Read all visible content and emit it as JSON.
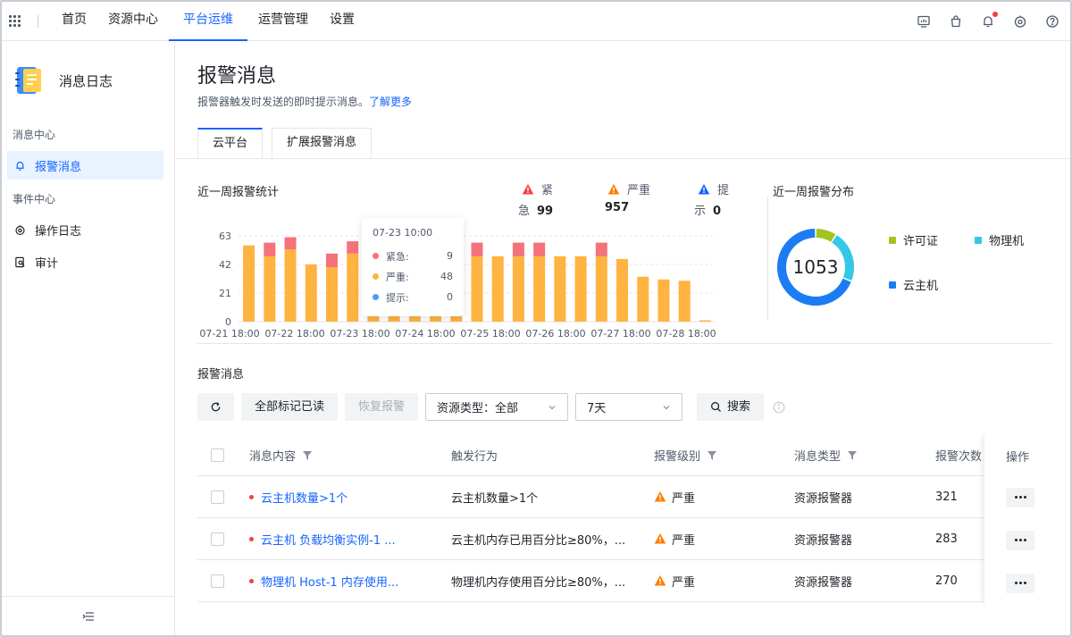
{
  "nav": {
    "items": [
      {
        "label": "首页"
      },
      {
        "label": "资源中心"
      },
      {
        "label": "平台运维"
      },
      {
        "label": "运营管理"
      },
      {
        "label": "设置"
      }
    ]
  },
  "sidebar": {
    "title": "消息日志",
    "group1": "消息中心",
    "group2": "事件中心",
    "items": [
      {
        "label": "报警消息"
      },
      {
        "label": "操作日志"
      },
      {
        "label": "审计"
      }
    ]
  },
  "page": {
    "title": "报警消息",
    "desc": "报警器触发时发送的即时提示消息。",
    "link": "了解更多"
  },
  "tabs": [
    {
      "label": "云平台"
    },
    {
      "label": "扩展报警消息"
    }
  ],
  "stats": {
    "title": "近一周报警统计",
    "urgent_label_a": "紧",
    "urgent_label_b": "急",
    "urgent_value": "99",
    "serious_label": "严重",
    "serious_value": "957",
    "hint_label_a": "提",
    "hint_label_b": "示",
    "hint_value": "0"
  },
  "chart_data": {
    "type": "bar",
    "stacked": true,
    "yticks": [
      "0",
      "21",
      "42",
      "63"
    ],
    "ylim": [
      0,
      63
    ],
    "xticks": [
      "07-21 18:00",
      "07-22 18:00",
      "07-23 18:00",
      "07-24 18:00",
      "07-25 18:00",
      "07-26 18:00",
      "07-27 18:00",
      "07-28 18:00"
    ],
    "series": [
      {
        "name": "严重",
        "color": "#ffb340",
        "values": [
          56,
          48,
          53,
          42,
          40,
          50,
          48,
          52,
          48,
          48,
          47,
          48,
          48,
          48,
          48,
          48,
          48,
          48,
          46,
          33,
          31,
          30,
          1
        ]
      },
      {
        "name": "紧急",
        "color": "#f5727a",
        "values": [
          0,
          10,
          9,
          0,
          10,
          9,
          9,
          8,
          8,
          10,
          10,
          10,
          0,
          10,
          10,
          0,
          0,
          10,
          0,
          0,
          0,
          0,
          0
        ]
      }
    ],
    "tooltip": {
      "time": "07-23 10:00",
      "rows": [
        {
          "name": "紧急:",
          "value": "9",
          "color": "#f5727a"
        },
        {
          "name": "严重:",
          "value": "48",
          "color": "#ffb340"
        },
        {
          "name": "提示:",
          "value": "0",
          "color": "#4a9ff5"
        }
      ]
    }
  },
  "distribution": {
    "title": "近一周报警分布",
    "total": "1053",
    "legend": [
      {
        "label": "许可证",
        "color": "#a0c520"
      },
      {
        "label": "物理机",
        "color": "#33c9e6"
      },
      {
        "label": "云主机",
        "color": "#1c7cf4"
      }
    ],
    "segments": [
      {
        "name": "许可证",
        "fraction": 0.09,
        "color": "#a0c520"
      },
      {
        "name": "物理机",
        "fraction": 0.22,
        "color": "#33c9e6"
      },
      {
        "name": "云主机",
        "fraction": 0.69,
        "color": "#1c7cf4"
      }
    ]
  },
  "list": {
    "title": "报警消息",
    "mark_read": "全部标记已读",
    "restore": "恢复报警",
    "resource_type": "资源类型：全部",
    "period": "7天",
    "search": "搜索"
  },
  "table": {
    "headers": {
      "content": "消息内容",
      "trigger": "触发行为",
      "level": "报警级别",
      "type": "消息类型",
      "count": "报警次数",
      "op": "操作"
    },
    "rows": [
      {
        "content": "云主机数量>1个",
        "trigger": "云主机数量>1个",
        "level": "严重",
        "type": "资源报警器",
        "count": "321"
      },
      {
        "content": "云主机 负载均衡实例-1 ...",
        "trigger": "云主机内存已用百分比≥80%，...",
        "level": "严重",
        "type": "资源报警器",
        "count": "283"
      },
      {
        "content": "物理机 Host-1 内存使用...",
        "trigger": "物理机内存使用百分比≥80%，...",
        "level": "严重",
        "type": "资源报警器",
        "count": "270"
      }
    ]
  }
}
